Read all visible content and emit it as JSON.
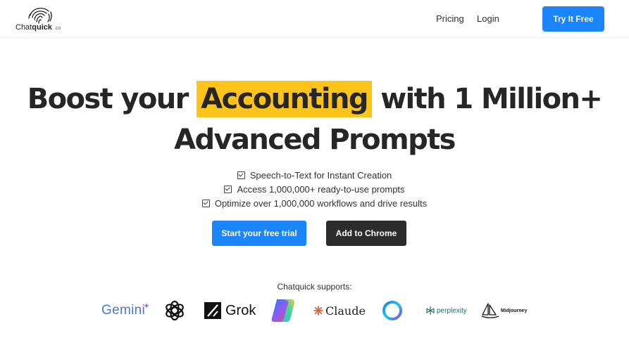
{
  "nav": {
    "logo_brand_regular": "Chat",
    "logo_brand_bold": "quick",
    "logo_suffix": ".co",
    "links": [
      "Pricing",
      "Login"
    ],
    "cta_label": "Try It Free"
  },
  "hero": {
    "title_part1": "Boost your ",
    "title_highlight": "Accounting",
    "title_part2": " with 1 Million+",
    "title_line2": "Advanced Prompts",
    "highlight_color": "#ffc31a"
  },
  "features": [
    "Speech-to-Text for Instant Creation",
    "Access 1,000,000+ ready-to-use prompts",
    "Optimize over 1,000,000 workflows and drive results"
  ],
  "buttons": {
    "trial_label": "Start your free trial",
    "chrome_label": "Add to Chrome"
  },
  "supports": {
    "heading": "Chatquick supports:",
    "brands": {
      "gemini": "Gemini",
      "grok": "Grok",
      "claude": "Claude",
      "perplexity": "perplexity",
      "midjourney": "Midjourney"
    }
  },
  "colors": {
    "primary": "#1a85ff",
    "dark_button": "#2c2c2c",
    "text": "#262626"
  }
}
